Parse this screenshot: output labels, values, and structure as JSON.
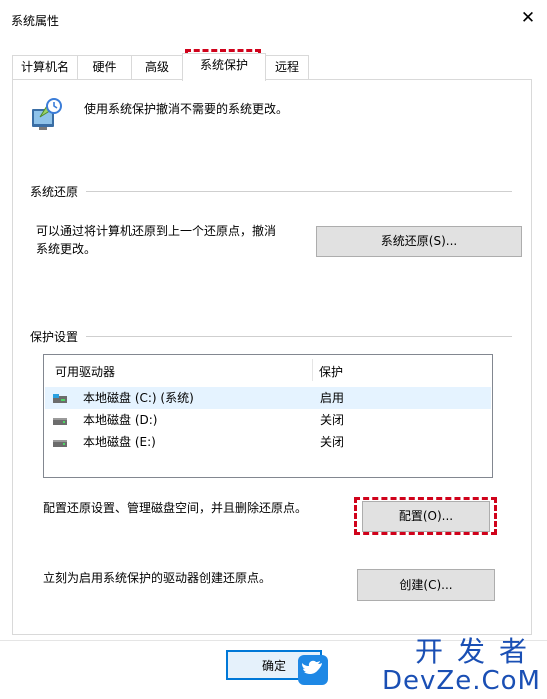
{
  "window": {
    "title": "系统属性",
    "close_glyph": "✕"
  },
  "tabs": [
    {
      "label": "计算机名"
    },
    {
      "label": "硬件"
    },
    {
      "label": "高级"
    },
    {
      "label": "系统保护"
    },
    {
      "label": "远程"
    }
  ],
  "intro_text": "使用系统保护撤消不需要的系统更改。",
  "system_restore": {
    "heading": "系统还原",
    "description_line1": "可以通过将计算机还原到上一个还原点，撤消",
    "description_line2": "系统更改。",
    "button": "系统还原(S)..."
  },
  "protection": {
    "heading": "保护设置",
    "columns": [
      "可用驱动器",
      "保护"
    ],
    "drives": [
      {
        "name": "本地磁盘 (C:) (系统)",
        "protection": "启用"
      },
      {
        "name": "本地磁盘 (D:)",
        "protection": "关闭"
      },
      {
        "name": "本地磁盘 (E:)",
        "protection": "关闭"
      }
    ],
    "configure_text": "配置还原设置、管理磁盘空间，并且删除还原点。",
    "configure_button": "配置(O)...",
    "create_text": "立刻为启用系统保护的驱动器创建还原点。",
    "create_button": "创建(C)..."
  },
  "footer": {
    "ok_button": "确定"
  },
  "watermark": {
    "line1": "开发者",
    "line2": "DevZe.CoM"
  },
  "colors": {
    "highlight": "#d0021b",
    "selection": "#e5f3ff",
    "watermark": "#1a4fb4"
  }
}
